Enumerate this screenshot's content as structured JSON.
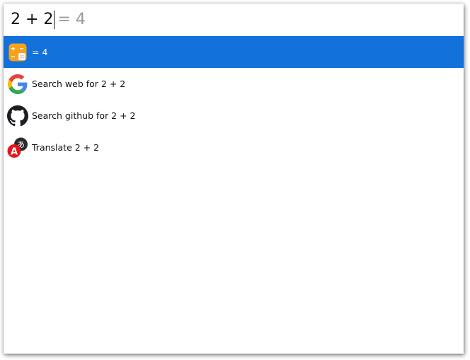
{
  "colors": {
    "accent": "#1271db",
    "hint_gray": "#9a9a9a"
  },
  "search": {
    "query": "2 + 2",
    "inline_result": "= 4"
  },
  "results": [
    {
      "icon": "calculator-icon",
      "label": "= 4",
      "selected": true
    },
    {
      "icon": "google-icon",
      "label": "Search web for 2 + 2",
      "selected": false
    },
    {
      "icon": "github-icon",
      "label": "Search github for 2 + 2",
      "selected": false
    },
    {
      "icon": "translate-icon",
      "label": "Translate 2 + 2",
      "selected": false
    }
  ]
}
